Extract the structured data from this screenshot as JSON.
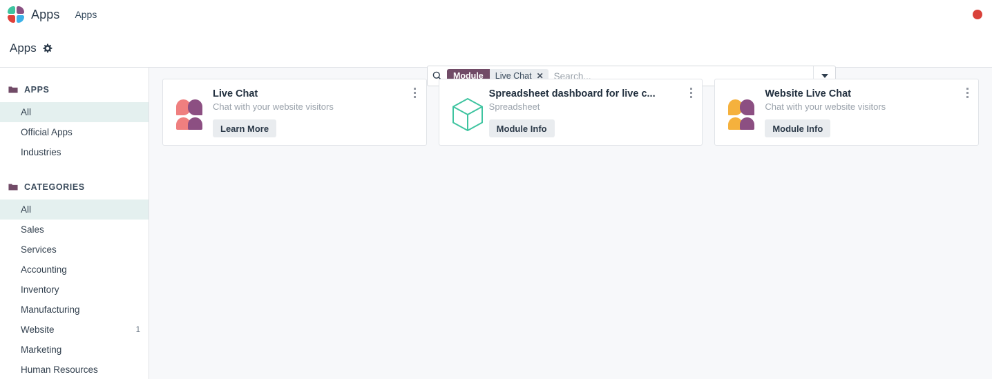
{
  "topbar": {
    "brand_name": "Apps",
    "menu_item": "Apps",
    "logo_icon": "apps-pinwheel-logo",
    "status_indicator_color": "#d9413a",
    "status_indicator_icon": "recording-dot-icon"
  },
  "control_row": {
    "page_title": "Apps",
    "gear_icon": "gear-icon"
  },
  "search": {
    "search_icon": "search-icon",
    "facet_label": "Module",
    "facet_value": "Live Chat",
    "facet_remove_icon": "close-x-icon",
    "placeholder": "Search...",
    "value": "",
    "dropdown_icon": "chevron-down-icon",
    "facet_label_color": "#714b67"
  },
  "sidebar": {
    "sections": [
      {
        "heading": "APPS",
        "folder_icon": "folder-icon",
        "items": [
          {
            "label": "All",
            "count": "",
            "active": true
          },
          {
            "label": "Official Apps",
            "count": "",
            "active": false
          },
          {
            "label": "Industries",
            "count": "",
            "active": false
          }
        ]
      },
      {
        "heading": "CATEGORIES",
        "folder_icon": "folder-icon",
        "items": [
          {
            "label": "All",
            "count": "",
            "active": true
          },
          {
            "label": "Sales",
            "count": "",
            "active": false
          },
          {
            "label": "Services",
            "count": "",
            "active": false
          },
          {
            "label": "Accounting",
            "count": "",
            "active": false
          },
          {
            "label": "Inventory",
            "count": "",
            "active": false
          },
          {
            "label": "Manufacturing",
            "count": "",
            "active": false
          },
          {
            "label": "Website",
            "count": "1",
            "active": false
          },
          {
            "label": "Marketing",
            "count": "",
            "active": false
          },
          {
            "label": "Human Resources",
            "count": "",
            "active": false
          }
        ]
      }
    ]
  },
  "cards": [
    {
      "title": "Live Chat",
      "subtitle": "Chat with your website visitors",
      "button_label": "Learn More",
      "icon": "live-chat-people-icon",
      "icon_type": "people",
      "icon_color_primary": "#ef7f7f",
      "icon_color_secondary": "#8c4f82",
      "menu_icon": "kebab-menu-icon"
    },
    {
      "title": "Spreadsheet dashboard for live c...",
      "subtitle": "Spreadsheet",
      "button_label": "Module Info",
      "icon": "module-cube-icon",
      "icon_type": "cube",
      "icon_color_primary": "#3fc4a0",
      "icon_color_secondary": "#3fc4a0",
      "menu_icon": "kebab-menu-icon"
    },
    {
      "title": "Website Live Chat",
      "subtitle": "Chat with your website visitors",
      "button_label": "Module Info",
      "icon": "website-live-chat-people-icon",
      "icon_type": "people",
      "icon_color_primary": "#f5b13d",
      "icon_color_secondary": "#8c4f82",
      "menu_icon": "kebab-menu-icon"
    }
  ]
}
